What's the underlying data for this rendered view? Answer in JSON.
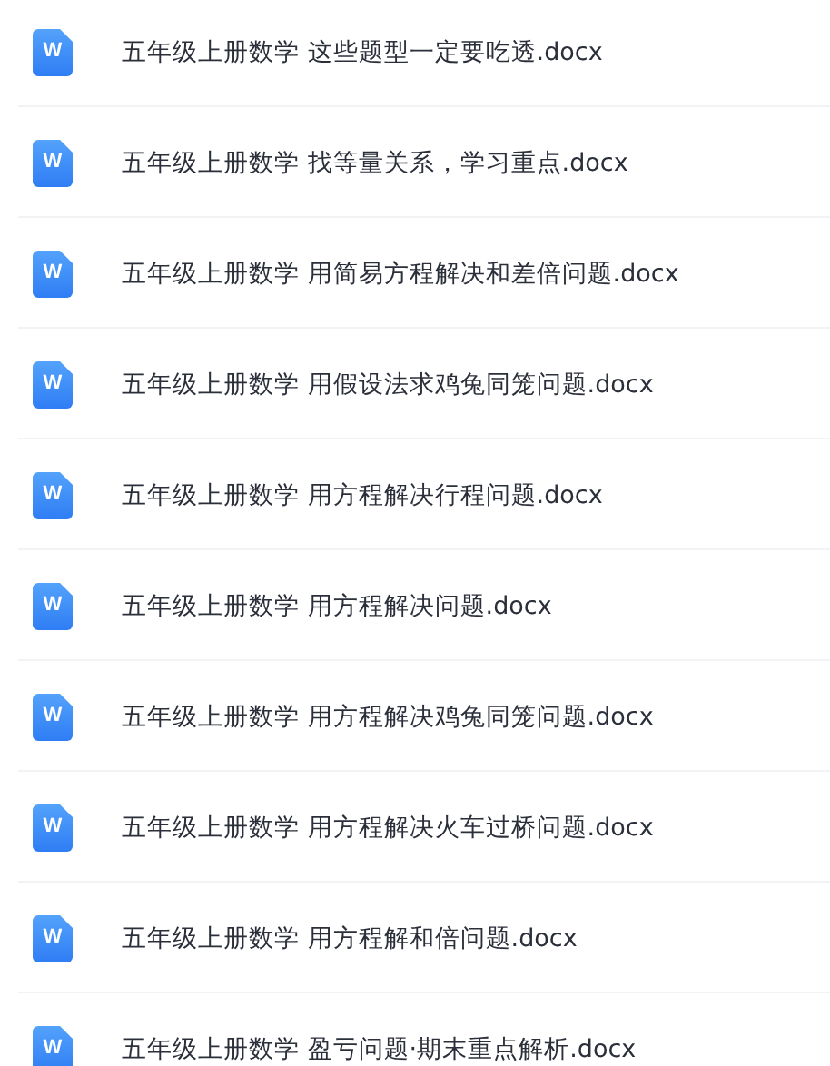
{
  "files": [
    {
      "icon_letter": "W",
      "name": "五年级上册数学 这些题型一定要吃透.docx"
    },
    {
      "icon_letter": "W",
      "name": "五年级上册数学 找等量关系，学习重点.docx"
    },
    {
      "icon_letter": "W",
      "name": "五年级上册数学 用简易方程解决和差倍问题.docx"
    },
    {
      "icon_letter": "W",
      "name": "五年级上册数学 用假设法求鸡兔同笼问题.docx"
    },
    {
      "icon_letter": "W",
      "name": "五年级上册数学 用方程解决行程问题.docx"
    },
    {
      "icon_letter": "W",
      "name": "五年级上册数学 用方程解决问题.docx"
    },
    {
      "icon_letter": "W",
      "name": "五年级上册数学 用方程解决鸡兔同笼问题.docx"
    },
    {
      "icon_letter": "W",
      "name": "五年级上册数学 用方程解决火车过桥问题.docx"
    },
    {
      "icon_letter": "W",
      "name": "五年级上册数学 用方程解和倍问题.docx"
    },
    {
      "icon_letter": "W",
      "name": "五年级上册数学 盈亏问题·期末重点解析.docx"
    }
  ]
}
